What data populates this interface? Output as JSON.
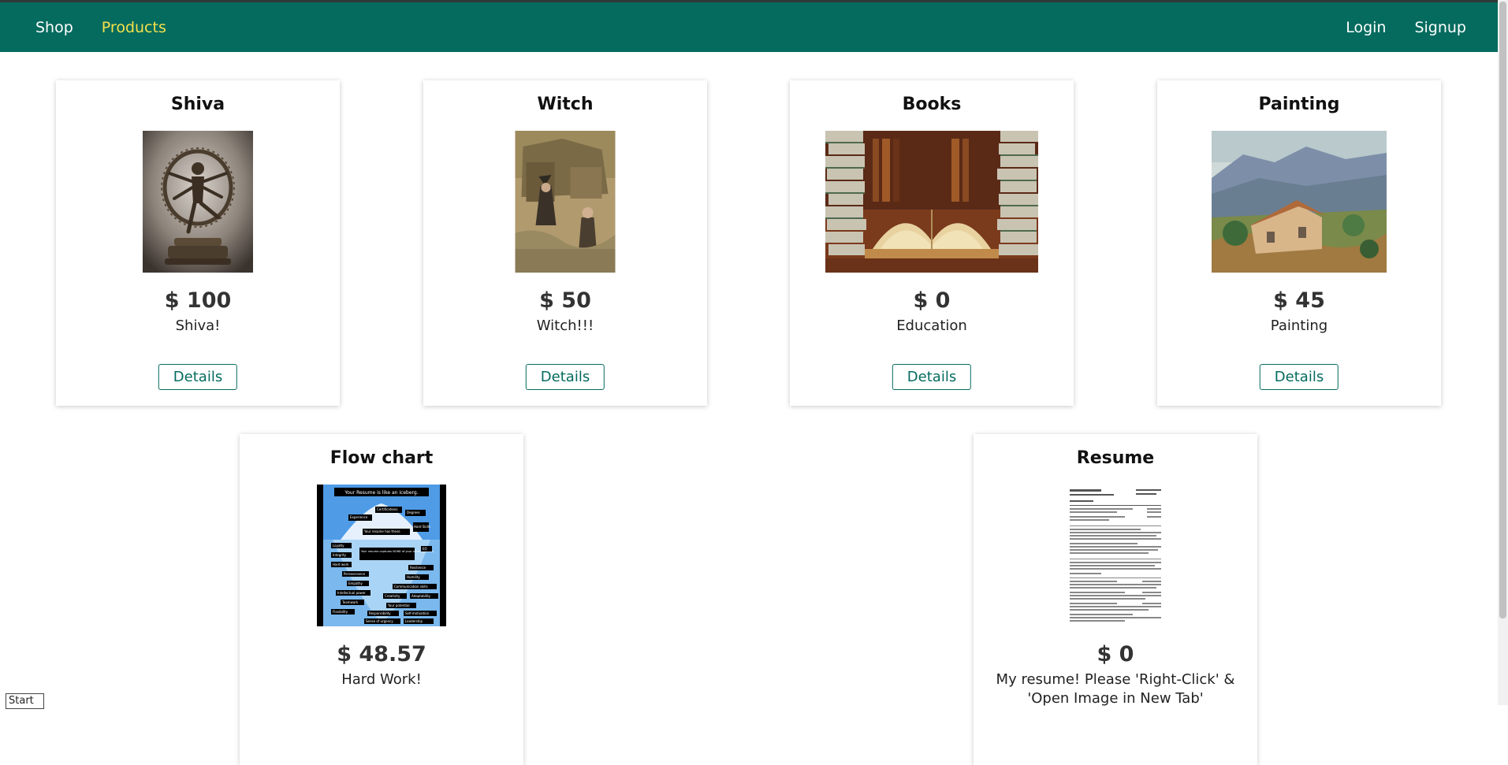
{
  "nav": {
    "left": [
      {
        "label": "Shop",
        "active": false
      },
      {
        "label": "Products",
        "active": true
      }
    ],
    "right": [
      {
        "label": "Login"
      },
      {
        "label": "Signup"
      }
    ]
  },
  "products": [
    {
      "title": "Shiva",
      "price": "$ 100",
      "description": "Shiva!",
      "button": "Details",
      "image": "shiva-statue"
    },
    {
      "title": "Witch",
      "price": "$ 50",
      "description": "Witch!!!",
      "button": "Details",
      "image": "witch-illustration"
    },
    {
      "title": "Books",
      "price": "$ 0",
      "description": "Education",
      "button": "Details",
      "image": "open-books"
    },
    {
      "title": "Painting",
      "price": "$ 45",
      "description": "Painting",
      "button": "Details",
      "image": "landscape-painting"
    },
    {
      "title": "Flow chart",
      "price": "$ 48.57",
      "description": "Hard Work!",
      "button": "Details",
      "image": "iceberg-chart"
    },
    {
      "title": "Resume",
      "price": "$ 0",
      "description": "My resume! Please 'Right-Click' & 'Open Image in New Tab'",
      "button": "Details",
      "image": "resume-document"
    }
  ],
  "iceberg": {
    "heading": "Your Resume is like an iceberg.",
    "above": [
      "Certifications",
      "Experience",
      "Degrees",
      "Your resume has these",
      "Hard Skills"
    ],
    "callout": "Your resume captures NONE of your other qualities.",
    "below": [
      "Loyalty",
      "Integrity",
      "Hard work",
      "Perseverance",
      "Empathy",
      "Intellectual power",
      "Teamwork",
      "Flexibility",
      "EQ",
      "Resilience",
      "Humility",
      "Communication skills",
      "Creativity",
      "Adaptability",
      "Your potential",
      "Responsibility",
      "Self-motivation",
      "Sense of urgency",
      "Leadership"
    ]
  },
  "colors": {
    "navbar": "#046b5e",
    "active_link": "#f5e14a",
    "button_border": "#046b5e"
  },
  "start_label": "Start"
}
